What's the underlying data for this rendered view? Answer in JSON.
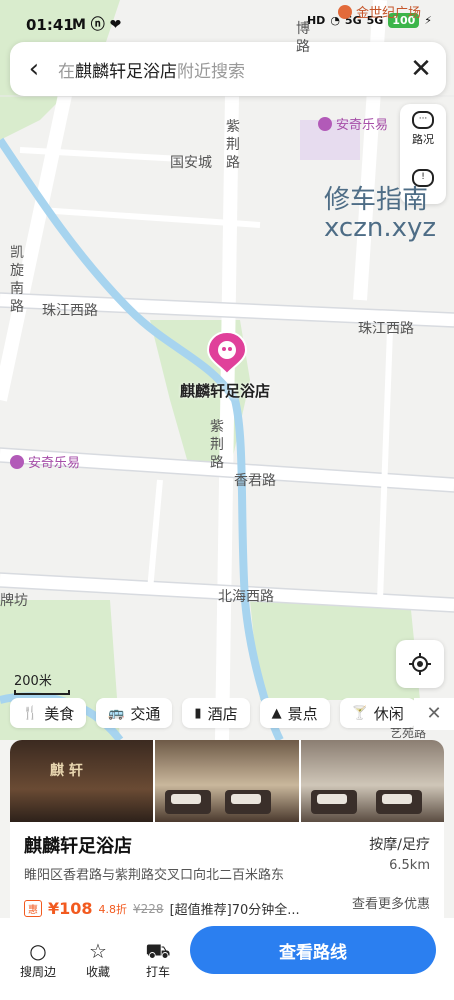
{
  "status": {
    "time": "01:41",
    "apps": "M ⓝ ❤",
    "hd": "HD",
    "net1": "5G",
    "net2": "5G",
    "battery": "100"
  },
  "search": {
    "prefix": "在",
    "place": "麒麟轩足浴店",
    "suffix": "附近搜索"
  },
  "side": {
    "traffic": "路况",
    "report": "!"
  },
  "watermark": {
    "line1": "修车指南",
    "line2": "xczn.xyz"
  },
  "map": {
    "roads": [
      "国安城",
      "珠江西路",
      "珠江西路",
      "香君路",
      "北海西路",
      "紫荆路",
      "紫荆路",
      "凯旋南路",
      "牌坊",
      "博路",
      "艺苑路"
    ],
    "pois": [
      "安奇乐易",
      "安奇乐易",
      "金世纪广场"
    ],
    "pin_name": "麒麟轩足浴店",
    "scale": "200米"
  },
  "categories": [
    "美食",
    "交通",
    "酒店",
    "景点",
    "休闲"
  ],
  "place": {
    "name": "麒麟轩足浴店",
    "category": "按摩/足疗",
    "address": "睢阳区香君路与紫荆路交叉口向北二百米路东",
    "distance": "6.5km",
    "photo_sign": "麒 轩",
    "deal": {
      "tag": "惠",
      "price": "¥108",
      "discount": "4.8折",
      "original": "¥228",
      "text": "[超值推荐]70分钟全..."
    },
    "more": "查看更多优惠"
  },
  "bottom": {
    "nearby": "搜周边",
    "fav": "收藏",
    "taxi": "打车",
    "route": "查看路线"
  }
}
